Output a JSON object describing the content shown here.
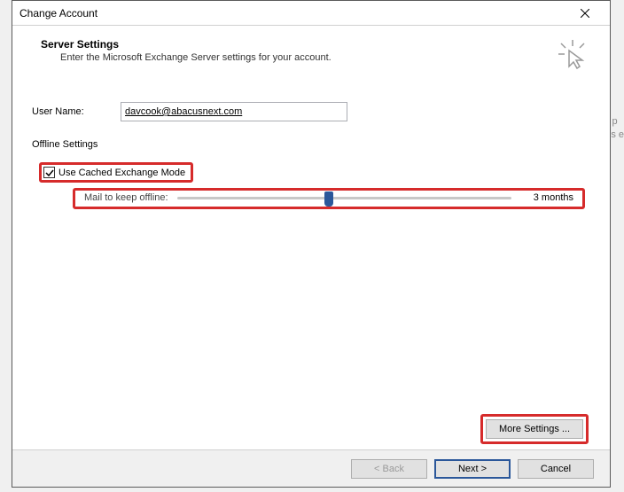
{
  "titlebar": {
    "title": "Change Account"
  },
  "header": {
    "title": "Server Settings",
    "subtitle": "Enter the Microsoft Exchange Server settings for your account."
  },
  "username": {
    "label": "User Name:",
    "value": "davcook@abacusnext.com"
  },
  "offline": {
    "section_label": "Offline Settings",
    "checkbox_label": "Use Cached Exchange Mode",
    "checked": true,
    "slider_label": "Mail to keep offline:",
    "slider_value_label": "3 months"
  },
  "buttons": {
    "more_settings": "More Settings ...",
    "back": "< Back",
    "next": "Next >",
    "cancel": "Cancel"
  },
  "bg": {
    "line1": "or p",
    "line2": "this e"
  }
}
